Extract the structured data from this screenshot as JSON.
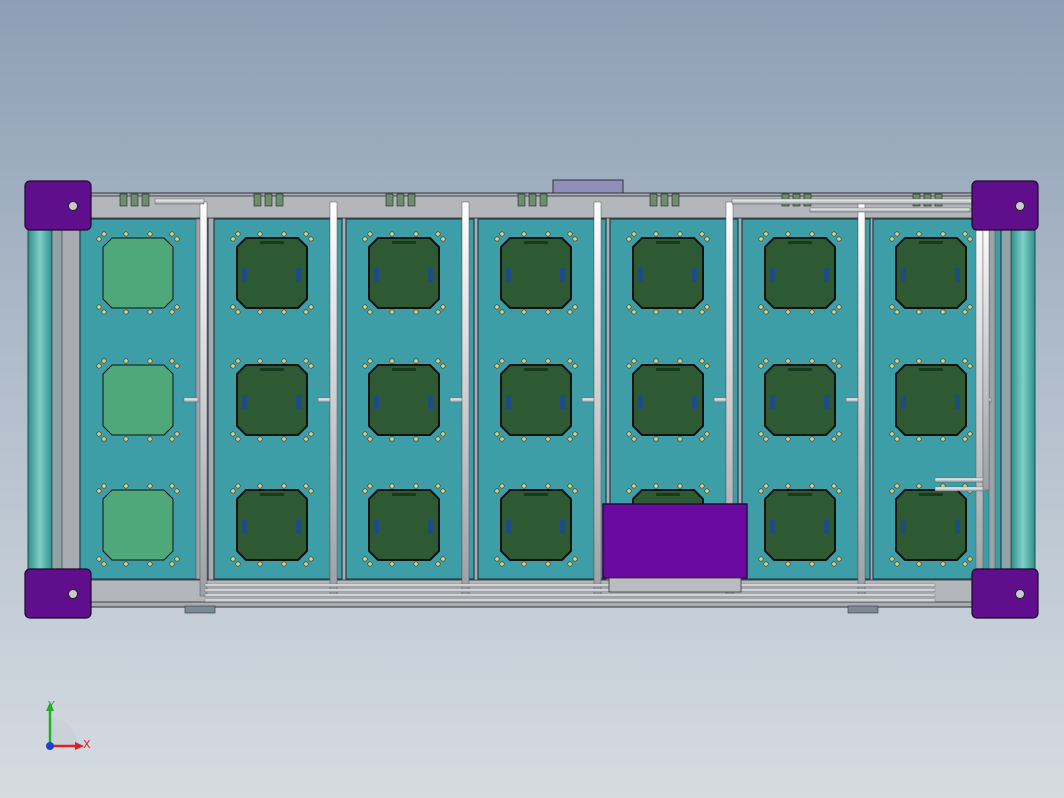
{
  "viewport": {
    "background_top": "#8e9fb5",
    "background_bottom": "#d5dbe1"
  },
  "assembly": {
    "frame_color": "#a9adb3",
    "panel_color": "#3e9ea8",
    "corner_block_color": "#5f0e8c",
    "enclosure_color": "#6a0a9e",
    "board_dark_color": "#2d5a33",
    "board_light_color": "#4fa87a",
    "pipe_color": "#e4e6e9",
    "bays": 7,
    "rows_per_bay": 3,
    "light_board_bay": 1
  },
  "triad": {
    "x_label": "X",
    "y_label": "Y",
    "x_color": "#e02020",
    "y_color": "#20b020",
    "z_color": "#2040d0"
  }
}
